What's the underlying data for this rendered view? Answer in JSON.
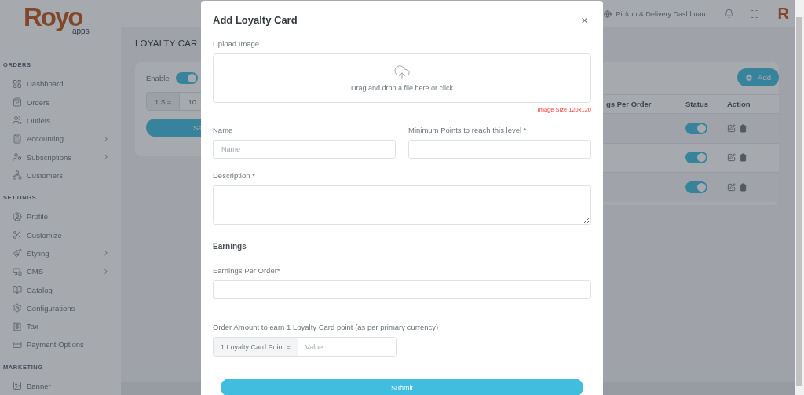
{
  "sidebar": {
    "logo": {
      "word": "Royo",
      "sub": "apps"
    },
    "sections": [
      {
        "title": "ORDERS",
        "items": [
          {
            "label": "Dashboard",
            "expandable": false
          },
          {
            "label": "Orders",
            "expandable": false
          },
          {
            "label": "Outlets",
            "expandable": false
          },
          {
            "label": "Accounting",
            "expandable": true
          },
          {
            "label": "Subscriptions",
            "expandable": true
          },
          {
            "label": "Customers",
            "expandable": false
          }
        ]
      },
      {
        "title": "SETTINGS",
        "items": [
          {
            "label": "Profile",
            "expandable": false
          },
          {
            "label": "Customize",
            "expandable": false
          },
          {
            "label": "Styling",
            "expandable": true
          },
          {
            "label": "CMS",
            "expandable": true
          },
          {
            "label": "Catalog",
            "expandable": false
          },
          {
            "label": "Configurations",
            "expandable": false
          },
          {
            "label": "Tax",
            "expandable": false
          },
          {
            "label": "Payment Options",
            "expandable": false
          }
        ]
      },
      {
        "title": "MARKETING",
        "items": [
          {
            "label": "Banner",
            "expandable": false
          }
        ]
      }
    ]
  },
  "header": {
    "link": "Pickup & Delivery Dashboard",
    "avatar": "R"
  },
  "page": {
    "title": "LOYALTY CAR",
    "settings": {
      "enable_label": "Enable",
      "enabled": true,
      "rate_prefix": "1 $ =",
      "rate_value": "10",
      "save_button": "Sa"
    },
    "table": {
      "add_button": "Add",
      "columns": [
        "gs Per Order",
        "Status",
        "Action"
      ],
      "rows": [
        {
          "status_on": true
        },
        {
          "status_on": true
        },
        {
          "status_on": true
        }
      ]
    }
  },
  "modal": {
    "title": "Add Loyalty Card",
    "close": "×",
    "upload_label": "Upload Image",
    "dropzone_text": "Drag and drop a file here or click",
    "image_size_note": "Image Size 120x120",
    "name_label": "Name",
    "name_placeholder": "Name",
    "min_points_label": "Minimum Points to reach this level *",
    "description_label": "Description *",
    "earnings_heading": "Earnings",
    "earnings_label": "Earnings Per Order*",
    "amount_label": "Order Amount to earn 1 Loyalty Card point (as per primary currency)",
    "amount_prefix": "1 Loyalty Card Point =",
    "amount_placeholder": "Value",
    "submit": "Submit"
  }
}
